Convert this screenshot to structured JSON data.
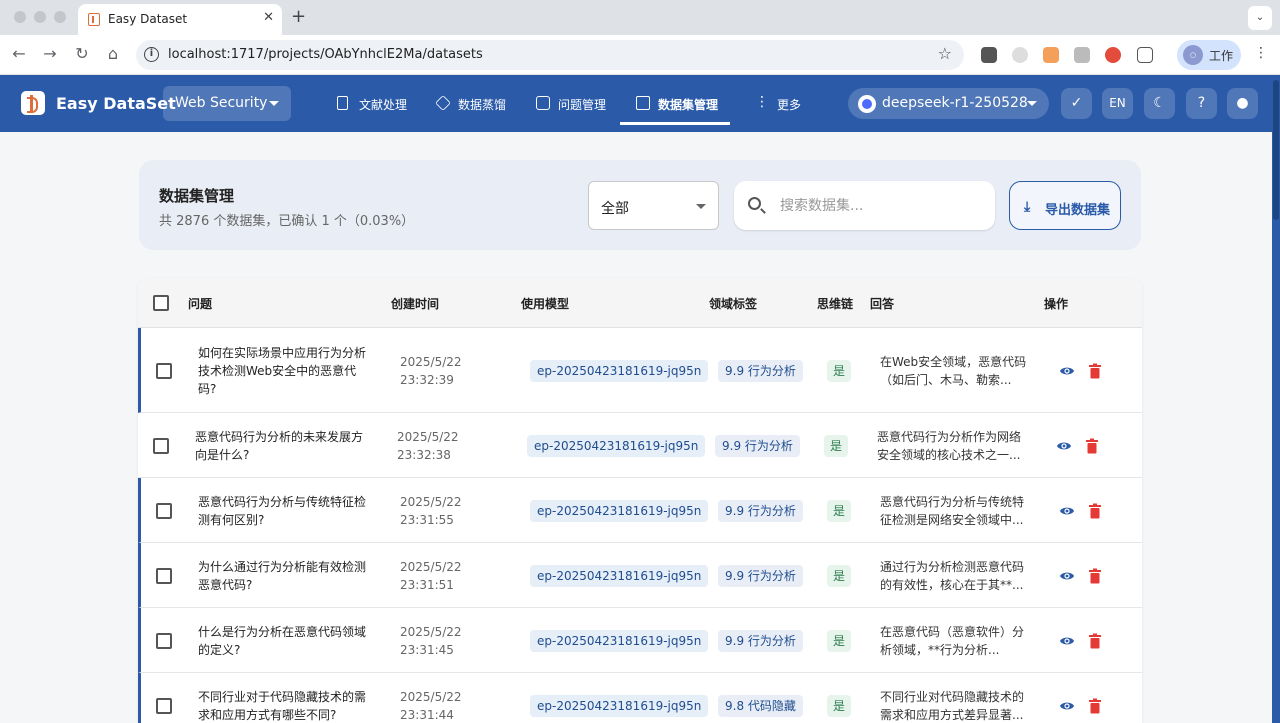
{
  "browser": {
    "tab_title": "Easy Dataset",
    "url": "localhost:1717/projects/OAbYnhclE2Ma/datasets",
    "profile_label": "工作"
  },
  "header": {
    "app_name": "Easy DataSet",
    "project": "Web Security",
    "nav": [
      {
        "label": "文献处理",
        "icon": "document-icon"
      },
      {
        "label": "数据蒸馏",
        "icon": "cube-icon"
      },
      {
        "label": "问题管理",
        "icon": "chat-icon"
      },
      {
        "label": "数据集管理",
        "icon": "grid-icon",
        "active": true
      },
      {
        "label": "更多",
        "icon": "more-vertical-icon"
      }
    ],
    "model": "deepseek-r1-250528",
    "lang_button": "EN"
  },
  "summary": {
    "title": "数据集管理",
    "subtitle": "共 2876 个数据集，已确认 1 个（0.03%）",
    "filter_value": "全部",
    "search_placeholder": "搜索数据集...",
    "export_label": "导出数据集"
  },
  "table": {
    "columns": [
      "问题",
      "创建时间",
      "使用模型",
      "领域标签",
      "思维链",
      "回答",
      "操作"
    ],
    "rows": [
      {
        "question": "如何在实际场景中应用行为分析技术检测Web安全中的恶意代码?",
        "date": "2025/5/22",
        "time": "23:32:39",
        "model": "ep-20250423181619-jq95n",
        "tag": "9.9 行为分析",
        "cot": "是",
        "answer": "在Web安全领域，恶意代码（如后门、木马、勒索..."
      },
      {
        "question": "恶意代码行为分析的未来发展方向是什么?",
        "date": "2025/5/22",
        "time": "23:32:38",
        "model": "ep-20250423181619-jq95n",
        "tag": "9.9 行为分析",
        "cot": "是",
        "answer": "恶意代码行为分析作为网络安全领域的核心技术之一..."
      },
      {
        "question": "恶意代码行为分析与传统特征检测有何区别?",
        "date": "2025/5/22",
        "time": "23:31:55",
        "model": "ep-20250423181619-jq95n",
        "tag": "9.9 行为分析",
        "cot": "是",
        "answer": "恶意代码行为分析与传统特征检测是网络安全领域中..."
      },
      {
        "question": "为什么通过行为分析能有效检测恶意代码?",
        "date": "2025/5/22",
        "time": "23:31:51",
        "model": "ep-20250423181619-jq95n",
        "tag": "9.9 行为分析",
        "cot": "是",
        "answer": "通过行为分析检测恶意代码的有效性，核心在于其**..."
      },
      {
        "question": "什么是行为分析在恶意代码领域的定义?",
        "date": "2025/5/22",
        "time": "23:31:45",
        "model": "ep-20250423181619-jq95n",
        "tag": "9.9 行为分析",
        "cot": "是",
        "answer": "在恶意代码（恶意软件）分析领域，**行为分析..."
      },
      {
        "question": "不同行业对于代码隐藏技术的需求和应用方式有哪些不同?",
        "date": "2025/5/22",
        "time": "23:31:44",
        "model": "ep-20250423181619-jq95n",
        "tag": "9.8 代码隐藏",
        "cot": "是",
        "answer": "不同行业对代码隐藏技术的需求和应用方式差异显著..."
      }
    ]
  },
  "colors": {
    "brand": "#2a5aa8",
    "danger": "#e53935",
    "success": "#2e7d4f"
  }
}
